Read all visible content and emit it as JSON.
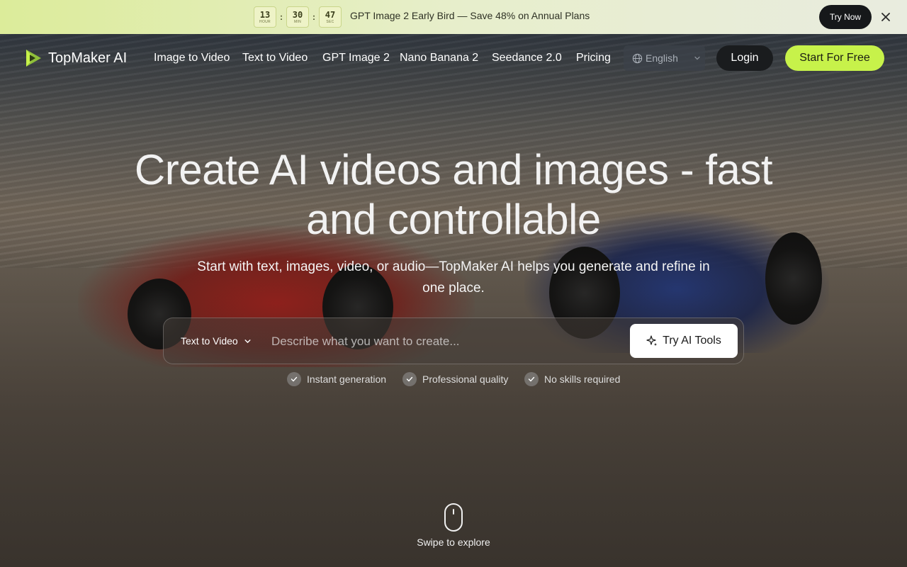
{
  "promo": {
    "countdown": [
      {
        "value": "13",
        "unit": "HOUR"
      },
      {
        "value": "30",
        "unit": "MIN"
      },
      {
        "value": "47",
        "unit": "SEC"
      }
    ],
    "separator": ":",
    "text": "GPT Image 2 Early Bird — Save 48% on Annual Plans",
    "cta": "Try Now",
    "close_icon": "close-icon"
  },
  "nav": {
    "brand": "TopMaker AI",
    "links": [
      "Image to Video",
      "Text to Video",
      "GPT Image 2",
      "Nano Banana 2",
      "Seedance 2.0",
      "Pricing"
    ],
    "language": "English",
    "login": "Login",
    "start": "Start For Free"
  },
  "hero": {
    "title": "Create AI videos and images - fast and controllable",
    "subtitle": "Start with text, images, video, or audio—TopMaker AI helps you generate and refine in one place."
  },
  "prompt": {
    "mode": "Text to Video",
    "placeholder": "Describe what you want to create...",
    "submit": "Try AI Tools"
  },
  "features": [
    "Instant generation",
    "Professional quality",
    "No skills required"
  ],
  "scroll_hint": "Swipe to explore",
  "colors": {
    "accent": "#c7f24a",
    "promo_bg": "#dcec9a",
    "dark_button": "#16181a"
  }
}
